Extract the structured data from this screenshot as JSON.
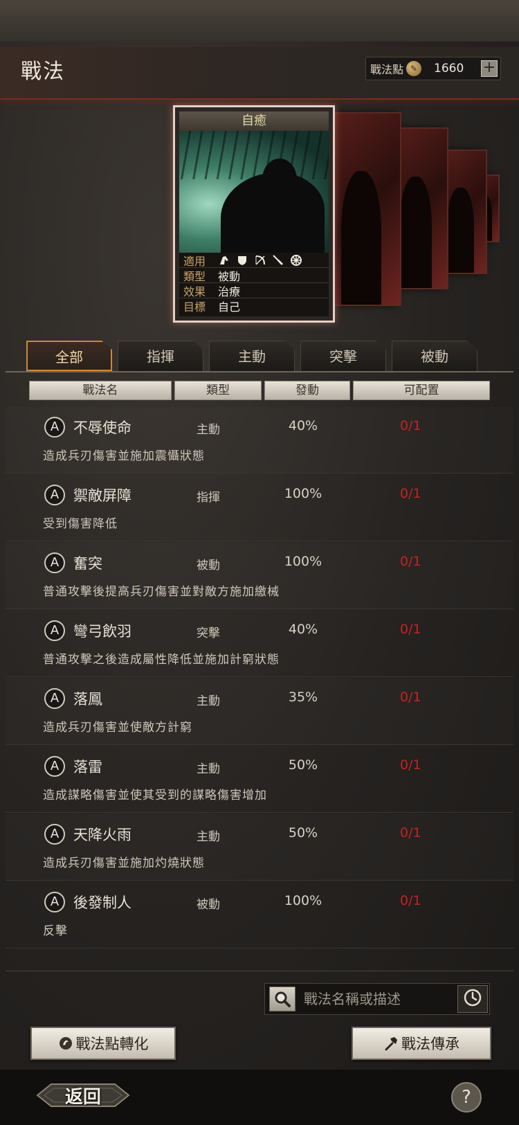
{
  "header": {
    "title": "戰法",
    "points_label": "戰法點",
    "points_value": "1660",
    "plus_label": "+"
  },
  "card": {
    "title": "自癒",
    "info": [
      {
        "key": "適用",
        "value": ""
      },
      {
        "key": "類型",
        "value": "被動"
      },
      {
        "key": "效果",
        "value": "治療"
      },
      {
        "key": "目標",
        "value": "自己"
      }
    ],
    "unit_icons": [
      "cavalry-icon",
      "shield-icon",
      "archer-icon",
      "spear-icon",
      "siege-icon"
    ]
  },
  "tabs": [
    {
      "label": "全部",
      "active": true
    },
    {
      "label": "指揮",
      "active": false
    },
    {
      "label": "主動",
      "active": false
    },
    {
      "label": "突擊",
      "active": false
    },
    {
      "label": "被動",
      "active": false
    }
  ],
  "columns": [
    "戰法名",
    "類型",
    "發動",
    "可配置"
  ],
  "skills": [
    {
      "grade": "A",
      "name": "不辱使命",
      "type": "主動",
      "rate": "40%",
      "avail": "0/1",
      "desc": "造成兵刃傷害並施加震懾狀態"
    },
    {
      "grade": "A",
      "name": "禦敵屏障",
      "type": "指揮",
      "rate": "100%",
      "avail": "0/1",
      "desc": "受到傷害降低"
    },
    {
      "grade": "A",
      "name": "奮突",
      "type": "被動",
      "rate": "100%",
      "avail": "0/1",
      "desc": "普通攻擊後提高兵刃傷害並對敵方施加繳械"
    },
    {
      "grade": "A",
      "name": "彎弓飲羽",
      "type": "突擊",
      "rate": "40%",
      "avail": "0/1",
      "desc": "普通攻擊之後造成屬性降低並施加計窮狀態"
    },
    {
      "grade": "A",
      "name": "落鳳",
      "type": "主動",
      "rate": "35%",
      "avail": "0/1",
      "desc": "造成兵刃傷害並使敵方計窮"
    },
    {
      "grade": "A",
      "name": "落雷",
      "type": "主動",
      "rate": "50%",
      "avail": "0/1",
      "desc": "造成謀略傷害並使其受到的謀略傷害增加"
    },
    {
      "grade": "A",
      "name": "天降火雨",
      "type": "主動",
      "rate": "50%",
      "avail": "0/1",
      "desc": "造成兵刃傷害並施加灼燒狀態"
    },
    {
      "grade": "A",
      "name": "後發制人",
      "type": "被動",
      "rate": "100%",
      "avail": "0/1",
      "desc": "反擊"
    }
  ],
  "search": {
    "placeholder": "戰法名稱或描述"
  },
  "buttons": {
    "convert": "戰法點轉化",
    "inherit": "戰法傳承",
    "back": "返回",
    "help": "?"
  },
  "colors": {
    "accent_gold": "#c98a3a",
    "avail_red": "#c42323",
    "card_border": "#e6d0c6"
  }
}
